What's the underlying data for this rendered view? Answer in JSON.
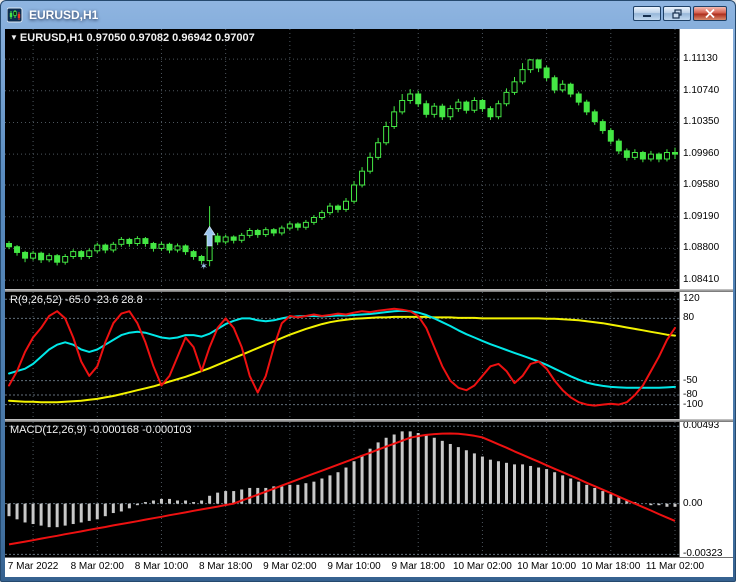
{
  "window": {
    "title": "EURUSD,H1"
  },
  "chart_data": [
    {
      "type": "candlestick",
      "marker": "▼",
      "title": "EURUSD,H1  0.97050 0.97082 0.96942 0.97007",
      "price_labels": [
        "1.11130",
        "1.10740",
        "1.10350",
        "1.09960",
        "1.09580",
        "1.09190",
        "1.08800",
        "1.08410"
      ],
      "price_range": [
        1.083,
        1.115
      ],
      "colors": {
        "bull_fill": "#000000",
        "bear_fill": "#44e744",
        "candle_border": "#44e744",
        "wick": "#44e744"
      },
      "annotations": {
        "index": 25,
        "arrow_top_price": 1.0907,
        "star_price": 1.0858,
        "color": "#9cc6ee",
        "star_glyph": "✶"
      },
      "candles": [
        [
          1.0886,
          1.0889,
          1.0879,
          1.0882
        ],
        [
          1.0882,
          1.0884,
          1.0871,
          1.0875
        ],
        [
          1.0875,
          1.0877,
          1.0863,
          1.0868
        ],
        [
          1.0868,
          1.0877,
          1.0865,
          1.0874
        ],
        [
          1.0874,
          1.0876,
          1.0862,
          1.0866
        ],
        [
          1.0866,
          1.0874,
          1.0863,
          1.0871
        ],
        [
          1.0871,
          1.0873,
          1.0859,
          1.0863
        ],
        [
          1.0863,
          1.0873,
          1.086,
          1.087
        ],
        [
          1.087,
          1.0879,
          1.0867,
          1.0876
        ],
        [
          1.0876,
          1.0878,
          1.0866,
          1.087
        ],
        [
          1.087,
          1.088,
          1.0867,
          1.0877
        ],
        [
          1.0877,
          1.0887,
          1.0874,
          1.0884
        ],
        [
          1.0884,
          1.0886,
          1.0874,
          1.0878
        ],
        [
          1.0878,
          1.0888,
          1.0875,
          1.0885
        ],
        [
          1.0885,
          1.0894,
          1.0882,
          1.0891
        ],
        [
          1.0891,
          1.0893,
          1.0882,
          1.0886
        ],
        [
          1.0886,
          1.0895,
          1.0883,
          1.0892
        ],
        [
          1.0892,
          1.0894,
          1.0882,
          1.0886
        ],
        [
          1.0886,
          1.0888,
          1.0876,
          1.088
        ],
        [
          1.088,
          1.0888,
          1.0877,
          1.0885
        ],
        [
          1.0885,
          1.0887,
          1.0874,
          1.0878
        ],
        [
          1.0878,
          1.0886,
          1.0875,
          1.0883
        ],
        [
          1.0883,
          1.0885,
          1.0872,
          1.0876
        ],
        [
          1.0876,
          1.0878,
          1.0866,
          1.087
        ],
        [
          1.087,
          1.0872,
          1.0861,
          1.0865
        ],
        [
          1.0865,
          1.0932,
          1.0858,
          1.0895
        ],
        [
          1.0895,
          1.0899,
          1.0884,
          1.0888
        ],
        [
          1.0888,
          1.0897,
          1.0885,
          1.0894
        ],
        [
          1.0894,
          1.0896,
          1.0886,
          1.089
        ],
        [
          1.089,
          1.0899,
          1.0887,
          1.0896
        ],
        [
          1.0896,
          1.0905,
          1.0893,
          1.0902
        ],
        [
          1.0902,
          1.0904,
          1.0893,
          1.0897
        ],
        [
          1.0897,
          1.0906,
          1.0894,
          1.0903
        ],
        [
          1.0903,
          1.0905,
          1.0895,
          1.0899
        ],
        [
          1.0899,
          1.0908,
          1.0896,
          1.0905
        ],
        [
          1.0905,
          1.0913,
          1.0902,
          1.091
        ],
        [
          1.091,
          1.0912,
          1.0902,
          1.0906
        ],
        [
          1.0906,
          1.0915,
          1.0903,
          1.0912
        ],
        [
          1.0912,
          1.0921,
          1.0909,
          1.0918
        ],
        [
          1.0918,
          1.0927,
          1.0915,
          1.0924
        ],
        [
          1.0924,
          1.0936,
          1.0921,
          1.0932
        ],
        [
          1.0932,
          1.0934,
          1.0924,
          1.0928
        ],
        [
          1.0928,
          1.0942,
          1.0925,
          1.0938
        ],
        [
          1.0938,
          1.0963,
          1.0935,
          1.0958
        ],
        [
          1.0958,
          1.098,
          1.0955,
          1.0975
        ],
        [
          1.0975,
          1.0998,
          1.0972,
          1.0992
        ],
        [
          1.0992,
          1.1016,
          1.0989,
          1.101
        ],
        [
          1.101,
          1.1036,
          1.1007,
          1.103
        ],
        [
          1.103,
          1.1055,
          1.1027,
          1.1048
        ],
        [
          1.1048,
          1.107,
          1.1045,
          1.1062
        ],
        [
          1.1062,
          1.1076,
          1.1058,
          1.107
        ],
        [
          1.107,
          1.1074,
          1.1054,
          1.1058
        ],
        [
          1.1058,
          1.1062,
          1.1041,
          1.1045
        ],
        [
          1.1045,
          1.1059,
          1.1041,
          1.1055
        ],
        [
          1.1055,
          1.1058,
          1.1038,
          1.1042
        ],
        [
          1.1042,
          1.1056,
          1.1038,
          1.1052
        ],
        [
          1.1052,
          1.1064,
          1.1048,
          1.106
        ],
        [
          1.106,
          1.1062,
          1.1046,
          1.105
        ],
        [
          1.105,
          1.1066,
          1.1047,
          1.1062
        ],
        [
          1.1062,
          1.1064,
          1.1048,
          1.1052
        ],
        [
          1.1052,
          1.1055,
          1.1038,
          1.1042
        ],
        [
          1.1042,
          1.1062,
          1.1039,
          1.1058
        ],
        [
          1.1058,
          1.1077,
          1.1055,
          1.1072
        ],
        [
          1.1072,
          1.1091,
          1.1069,
          1.1085
        ],
        [
          1.1085,
          1.1108,
          1.1082,
          1.11
        ],
        [
          1.11,
          1.1113,
          1.1096,
          1.1112
        ],
        [
          1.1112,
          1.1112,
          1.1097,
          1.1102
        ],
        [
          1.1102,
          1.1105,
          1.1086,
          1.109
        ],
        [
          1.109,
          1.1093,
          1.1071,
          1.1075
        ],
        [
          1.1075,
          1.1087,
          1.1072,
          1.1082
        ],
        [
          1.1082,
          1.1084,
          1.1066,
          1.107
        ],
        [
          1.107,
          1.1073,
          1.1056,
          1.106
        ],
        [
          1.106,
          1.1063,
          1.1044,
          1.1048
        ],
        [
          1.1048,
          1.1051,
          1.1032,
          1.1036
        ],
        [
          1.1036,
          1.1039,
          1.1021,
          1.1025
        ],
        [
          1.1025,
          1.1028,
          1.1008,
          1.1012
        ],
        [
          1.1012,
          1.1015,
          1.0996,
          1.1
        ],
        [
          1.1,
          1.1003,
          1.0988,
          1.0992
        ],
        [
          1.0992,
          1.1002,
          1.0989,
          1.0998
        ],
        [
          1.0998,
          1.1,
          1.0986,
          1.099
        ],
        [
          1.099,
          1.1,
          1.0987,
          1.0996
        ],
        [
          1.0996,
          1.0998,
          1.0986,
          1.099
        ],
        [
          1.099,
          1.1002,
          1.0987,
          1.0998
        ],
        [
          1.0998,
          1.1004,
          1.099,
          1.0996
        ]
      ]
    },
    {
      "type": "line",
      "label": "R(9,26,52) -65.0 -23.6 28.8",
      "range": [
        -130,
        135
      ],
      "levels": [
        120,
        80,
        -50,
        -80,
        -100
      ],
      "level_labels": [
        "120",
        "80",
        "-50",
        "-80",
        "-100"
      ],
      "series": [
        {
          "name": "slow-line",
          "color": "#f2f200",
          "values": [
            -92,
            -93,
            -94,
            -94,
            -95,
            -95,
            -95,
            -94,
            -93,
            -92,
            -90,
            -88,
            -85,
            -82,
            -78,
            -74,
            -70,
            -66,
            -62,
            -57,
            -52,
            -47,
            -42,
            -36,
            -30,
            -24,
            -17,
            -10,
            -3,
            4,
            11,
            18,
            25,
            32,
            39,
            46,
            52,
            58,
            63,
            68,
            72,
            75,
            77,
            79,
            80,
            81,
            82,
            82,
            83,
            83,
            83,
            83,
            83,
            82,
            82,
            82,
            81,
            81,
            81,
            80,
            80,
            80,
            80,
            80,
            80,
            80,
            80,
            79,
            79,
            78,
            77,
            76,
            74,
            72,
            70,
            67,
            64,
            61,
            58,
            55,
            52,
            49,
            46,
            44
          ]
        },
        {
          "name": "medium-line",
          "color": "#00e8e8",
          "values": [
            -35,
            -30,
            -25,
            -15,
            0,
            15,
            25,
            30,
            25,
            15,
            10,
            15,
            25,
            35,
            45,
            50,
            52,
            50,
            45,
            40,
            38,
            40,
            45,
            45,
            42,
            48,
            58,
            68,
            75,
            80,
            80,
            76,
            74,
            76,
            80,
            83,
            84,
            85,
            85,
            84,
            85,
            86,
            86,
            87,
            88,
            89,
            91,
            93,
            95,
            96,
            95,
            92,
            87,
            80,
            72,
            64,
            55,
            47,
            40,
            33,
            26,
            20,
            14,
            8,
            2,
            -4,
            -10,
            -17,
            -25,
            -33,
            -41,
            -48,
            -54,
            -58,
            -61,
            -63,
            -64,
            -65,
            -65,
            -65,
            -65,
            -65,
            -64,
            -63
          ]
        },
        {
          "name": "fast-line",
          "color": "#ee1111",
          "values": [
            -60,
            -30,
            10,
            40,
            60,
            85,
            95,
            80,
            40,
            -10,
            -40,
            -20,
            30,
            70,
            90,
            95,
            70,
            30,
            -20,
            -60,
            -40,
            0,
            40,
            20,
            -30,
            20,
            60,
            80,
            60,
            20,
            -40,
            -75,
            -40,
            20,
            70,
            85,
            82,
            85,
            88,
            85,
            87,
            90,
            88,
            92,
            95,
            93,
            96,
            98,
            100,
            98,
            95,
            85,
            60,
            20,
            -20,
            -50,
            -65,
            -70,
            -60,
            -40,
            -20,
            -15,
            -30,
            -55,
            -40,
            -15,
            -10,
            -25,
            -50,
            -70,
            -85,
            -95,
            -100,
            -102,
            -100,
            -98,
            -100,
            -95,
            -80,
            -60,
            -30,
            0,
            35,
            60
          ]
        }
      ]
    },
    {
      "type": "macd",
      "label": "MACD(12,26,9) -0.000168 -0.000103",
      "range": [
        -0.0034,
        0.0052
      ],
      "axis_labels": [
        {
          "text": "0.00493",
          "value": 0.00493
        },
        {
          "text": "0.00",
          "value": 0
        },
        {
          "text": "-0.00323",
          "value": -0.00323
        }
      ],
      "histogram_color": "#c8c8c8",
      "signal_color": "#ee1111",
      "histogram": [
        -0.0008,
        -0.001,
        -0.0012,
        -0.0013,
        -0.0014,
        -0.0015,
        -0.0015,
        -0.0014,
        -0.0013,
        -0.0012,
        -0.0011,
        -0.001,
        -0.0008,
        -0.0006,
        -0.0005,
        -0.0003,
        -0.0001,
        0.0001,
        0.0002,
        0.0003,
        0.0003,
        0.0002,
        0.0002,
        0.0001,
        0.0002,
        0.0005,
        0.0007,
        0.0008,
        0.0008,
        0.0009,
        0.001,
        0.001,
        0.001,
        0.0011,
        0.0011,
        0.0012,
        0.0012,
        0.0013,
        0.0014,
        0.0016,
        0.0018,
        0.002,
        0.0023,
        0.0027,
        0.0031,
        0.0035,
        0.0039,
        0.0042,
        0.0044,
        0.0046,
        0.0046,
        0.0045,
        0.0044,
        0.0042,
        0.004,
        0.0038,
        0.0036,
        0.0034,
        0.0032,
        0.003,
        0.0028,
        0.0027,
        0.0026,
        0.0025,
        0.0025,
        0.0024,
        0.0023,
        0.0022,
        0.002,
        0.0018,
        0.0016,
        0.0014,
        0.0012,
        0.001,
        0.0008,
        0.0006,
        0.0004,
        0.0002,
        0.0001,
        0,
        -0.0001,
        -0.0001,
        -0.0002,
        -0.0002
      ],
      "signal": [
        -0.0026,
        -0.00251,
        -0.00242,
        -0.00233,
        -0.00223,
        -0.00214,
        -0.00205,
        -0.00195,
        -0.00186,
        -0.00177,
        -0.00167,
        -0.00158,
        -0.00149,
        -0.00139,
        -0.0013,
        -0.00121,
        -0.00112,
        -0.00102,
        -0.00093,
        -0.00084,
        -0.00074,
        -0.00065,
        -0.00056,
        -0.00046,
        -0.00037,
        -0.00028,
        -0.00019,
        -9e-05,
        0,
        0.00019,
        0.00038,
        0.00057,
        0.00076,
        0.00095,
        0.00115,
        0.00134,
        0.00153,
        0.00172,
        0.00191,
        0.0021,
        0.00229,
        0.00248,
        0.00267,
        0.00286,
        0.00305,
        0.00324,
        0.00344,
        0.00363,
        0.00382,
        0.00401,
        0.0042,
        0.0043,
        0.00438,
        0.00443,
        0.00446,
        0.00447,
        0.00445,
        0.0044,
        0.00432,
        0.00422,
        0.004,
        0.00378,
        0.00356,
        0.00333,
        0.00311,
        0.00289,
        0.00267,
        0.00244,
        0.00222,
        0.002,
        0.00178,
        0.00156,
        0.00133,
        0.00111,
        0.00089,
        0.00067,
        0.00044,
        0.00022,
        0,
        -0.00022,
        -0.00044,
        -0.00067,
        -0.00089,
        -0.0011
      ]
    }
  ],
  "time_axis": {
    "labels": [
      {
        "text": "7 Mar 2022",
        "index": 3
      },
      {
        "text": "8 Mar 02:00",
        "index": 11
      },
      {
        "text": "8 Mar 10:00",
        "index": 19
      },
      {
        "text": "8 Mar 18:00",
        "index": 27
      },
      {
        "text": "9 Mar 02:00",
        "index": 35
      },
      {
        "text": "9 Mar 10:00",
        "index": 43
      },
      {
        "text": "9 Mar 18:00",
        "index": 51
      },
      {
        "text": "10 Mar 02:00",
        "index": 59
      },
      {
        "text": "10 Mar 10:00",
        "index": 67
      },
      {
        "text": "10 Mar 18:00",
        "index": 75
      },
      {
        "text": "11 Mar 02:00",
        "index": 83
      }
    ]
  }
}
